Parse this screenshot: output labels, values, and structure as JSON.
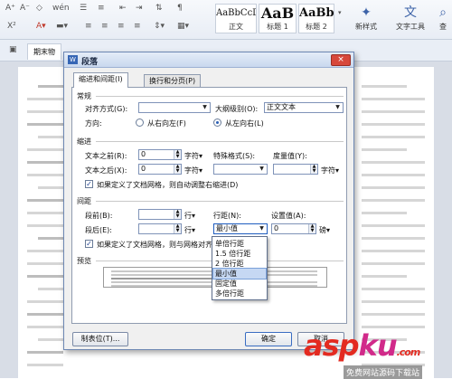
{
  "ribbon": {
    "styles": [
      {
        "sample": "AaBbCcD",
        "label": "正文"
      },
      {
        "sample": "AaB",
        "label": "标题 1"
      },
      {
        "sample": "AaBb(",
        "label": "标题 2"
      }
    ],
    "new_style_label": "新样式",
    "text_tools_label": "文字工具",
    "find_label": "查"
  },
  "doc": {
    "tab_label": "期末物"
  },
  "dialog": {
    "title": "段落",
    "close_label": "×",
    "tabs": [
      "缩进和间距(I)",
      "换行和分页(P)"
    ],
    "general": {
      "title": "常规",
      "alignment_label": "对齐方式(G):",
      "alignment_value": "",
      "outline_label": "大纲级别(O):",
      "outline_value": "正文文本",
      "direction_label": "方向:",
      "rtl_label": "从右向左(F)",
      "ltr_label": "从左向右(L)",
      "direction_selected": "ltr"
    },
    "indent": {
      "title": "缩进",
      "before_label": "文本之前(R):",
      "before_value": "0",
      "after_label": "文本之后(X):",
      "after_value": "0",
      "unit": "字符▾",
      "special_label": "特殊格式(S):",
      "special_value": "",
      "measure_label": "度量值(Y):",
      "measure_value": "",
      "measure_unit": "字符▾",
      "grid_check_label": "如果定义了文档网格，则自动调整右缩进(D)",
      "grid_checked": true
    },
    "spacing": {
      "title": "间距",
      "before_label": "段前(B):",
      "before_value": "",
      "before_unit": "行▾",
      "after_label": "段后(E):",
      "after_value": "",
      "after_unit": "行▾",
      "line_label": "行距(N):",
      "line_value": "最小值",
      "setting_label": "设置值(A):",
      "setting_value": "0",
      "setting_unit": "磅▾",
      "grid_check_label": "如果定义了文档网格，则与网格对齐",
      "grid_checked": true
    },
    "line_spacing_options": [
      "单倍行距",
      "1.5 倍行距",
      "2 倍行距",
      "最小值",
      "固定值",
      "多倍行距"
    ],
    "line_spacing_selected_index": 3,
    "preview": {
      "title": "预览"
    },
    "buttons": {
      "tabs": "制表位(T)...",
      "ok": "确定",
      "cancel": "取消"
    }
  },
  "watermark": {
    "main_a": "asp",
    "main_b": "ku",
    "suffix": ".com",
    "sub": "免费网站源码下载站"
  }
}
